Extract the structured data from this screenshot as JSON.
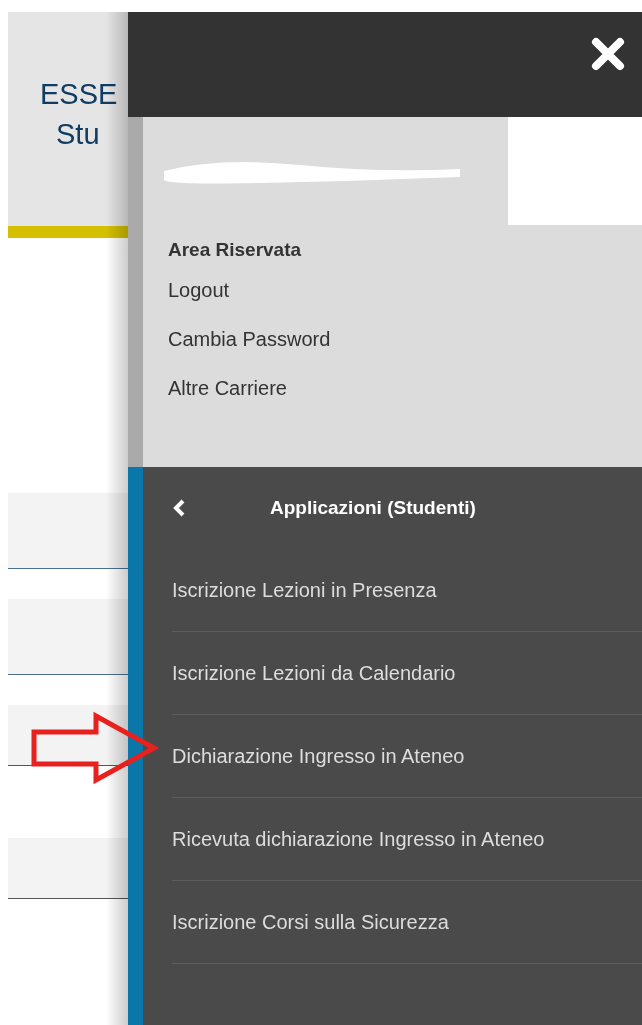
{
  "background_page": {
    "title_lines": [
      "ESSE",
      "Stu"
    ]
  },
  "side_panel": {
    "user_area": {
      "heading": "Area Riservata",
      "links": [
        "Logout",
        "Cambia Password",
        "Altre Carriere"
      ]
    },
    "menu": {
      "title": "Applicazioni (Studenti)",
      "items": [
        "Iscrizione Lezioni in Presenza",
        "Iscrizione Lezioni da Calendario",
        "Dichiarazione Ingresso in Ateneo",
        "Ricevuta dichiarazione Ingresso in Ateneo",
        "Iscrizione Corsi sulla Sicurezza"
      ]
    }
  }
}
